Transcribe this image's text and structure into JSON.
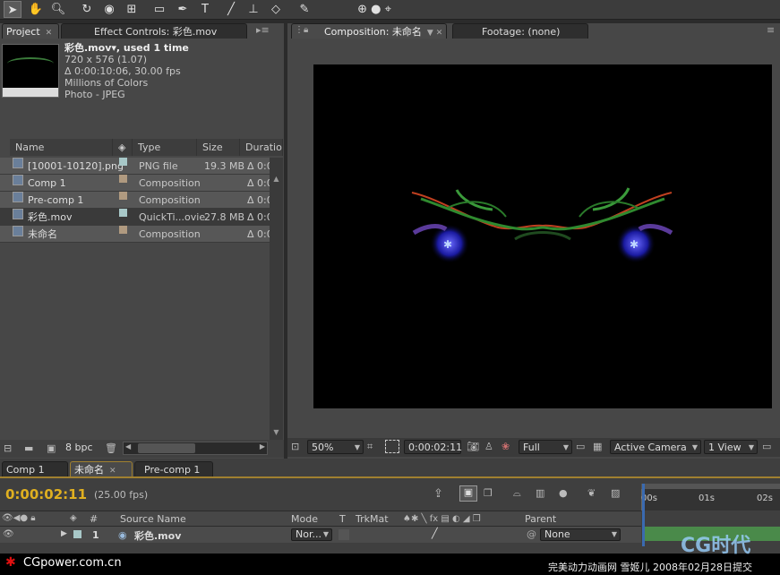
{
  "toolbar": {
    "icons": [
      "selection-tool-icon",
      "hand-tool-icon",
      "zoom-tool-icon",
      "rotate-tool-icon",
      "camera-orbit-icon",
      "pan-behind-icon",
      "mask-tool-icon",
      "pen-tool-icon",
      "type-tool-icon",
      "brush-tool-icon",
      "clone-stamp-icon",
      "eraser-icon",
      "puppet-pin-icon",
      "axis-icon"
    ]
  },
  "project": {
    "tab_project": "Project",
    "tab_effect": "Effect Controls: 彩色.mov",
    "info": {
      "name": "彩色.mov▾, used 1 time",
      "dims": "720 x 576 (1.07)",
      "duration": "Δ 0:00:10:06, 30.00 fps",
      "colors": "Millions of Colors",
      "codec": "Photo - JPEG"
    },
    "columns": [
      "Name",
      "Type",
      "Size",
      "Duration"
    ],
    "items": [
      {
        "name": "[10001-10120].png",
        "label_color": "#a8c8c8",
        "type": "PNG file",
        "size": "19.3 MB",
        "duration": "Δ 0:0",
        "icon": "png-sequence-icon"
      },
      {
        "name": "Comp 1",
        "label_color": "#b09a80",
        "type": "Composition",
        "size": "",
        "duration": "Δ 0:0",
        "icon": "composition-icon"
      },
      {
        "name": "Pre-comp 1",
        "label_color": "#b09a80",
        "type": "Composition",
        "size": "",
        "duration": "Δ 0:0",
        "icon": "composition-icon"
      },
      {
        "name": "彩色.mov",
        "label_color": "#a8c8c8",
        "type": "QuickTi...ovie",
        "size": "27.8 MB",
        "duration": "Δ 0:0",
        "icon": "quicktime-icon"
      },
      {
        "name": "未命名",
        "label_color": "#b09a80",
        "type": "Composition",
        "size": "",
        "duration": "Δ 0:0",
        "icon": "composition-icon"
      }
    ],
    "footer_bpc": "8 bpc"
  },
  "viewer": {
    "tab_comp": "Composition: 未命名",
    "tab_footage": "Footage: (none)",
    "zoom": "50%",
    "timecode": "0:00:02:11",
    "resolution": "Full",
    "camera": "Active Camera",
    "views": "1 View"
  },
  "timeline": {
    "tabs": [
      "Comp 1",
      "未命名",
      "Pre-comp 1"
    ],
    "timecode": "0:00:02:11",
    "fps": "(25.00 fps)",
    "ruler": [
      "00s",
      "01s",
      "02s"
    ],
    "columns": {
      "num": "#",
      "source": "Source Name",
      "mode": "Mode",
      "t": "T",
      "trkmat": "TrkMat",
      "parent": "Parent"
    },
    "layer": {
      "num": "1",
      "name": "彩色.mov",
      "mode": "Nor...",
      "parent": "None"
    }
  },
  "watermark": {
    "left": "CGpower.com.cn",
    "right": "完美动力动画网 雪姬儿 2008年02月28日提交",
    "logo": "CG时代"
  }
}
